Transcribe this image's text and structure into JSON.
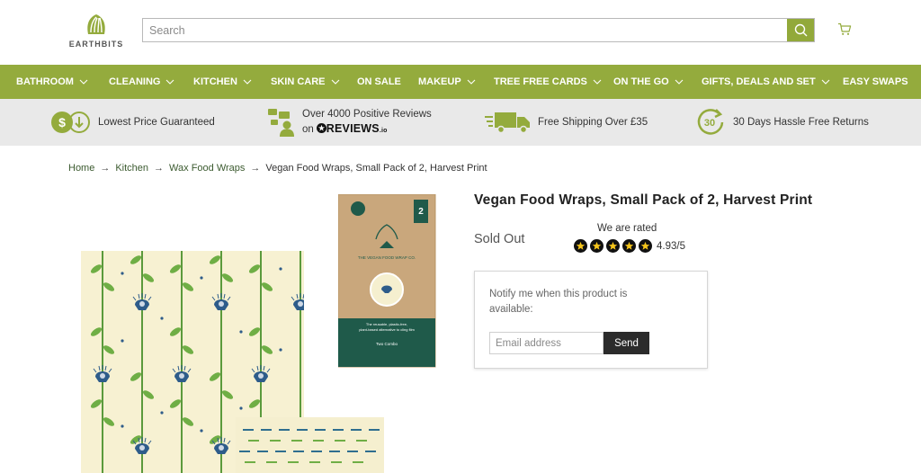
{
  "brand": {
    "name": "EARTHBITS",
    "accent": "#94ab3d"
  },
  "search": {
    "placeholder": "Search",
    "value": ""
  },
  "nav": {
    "items": [
      {
        "label": "BATHROOM",
        "dropdown": true
      },
      {
        "label": "CLEANING",
        "dropdown": true
      },
      {
        "label": "KITCHEN",
        "dropdown": true
      },
      {
        "label": "SKIN CARE",
        "dropdown": true
      },
      {
        "label": "ON SALE",
        "dropdown": false
      },
      {
        "label": "MAKEUP",
        "dropdown": true
      },
      {
        "label": "TREE FREE CARDS",
        "dropdown": true
      },
      {
        "label": "ON THE GO",
        "dropdown": true
      },
      {
        "label": "GIFTS, DEALS AND SET",
        "dropdown": true
      },
      {
        "label": "EASY SWAPS",
        "dropdown": false
      }
    ]
  },
  "usp": {
    "price": "Lowest Price Guaranteed",
    "reviews_line1": "Over 4000 Positive Reviews",
    "reviews_on": "on",
    "reviews_brand": "REVIEWS",
    "reviews_suffix": ".io",
    "shipping": "Free Shipping Over £35",
    "returns": "30 Days Hassle Free Returns",
    "returns_badge": "30"
  },
  "breadcrumb": {
    "home": "Home",
    "kitchen": "Kitchen",
    "category": "Wax Food Wraps",
    "current": "Vegan Food Wraps, Small Pack of 2, Harvest Print"
  },
  "product": {
    "title": "Vegan Food Wraps, Small Pack of 2, Harvest Print",
    "status": "Sold Out",
    "rated_label": "We are rated",
    "rating": "4.93/5",
    "stars": 5,
    "pack_brand": "THE VEGAN FOOD WRAP CO.",
    "pack_number": "2",
    "pack_tagline": "The reusable, plastic-free, plant-based alternative to cling film",
    "pack_combo": "Two Combo"
  },
  "notify": {
    "message": "Notify me when this product is available:",
    "email_placeholder": "Email address",
    "send_label": "Send"
  }
}
